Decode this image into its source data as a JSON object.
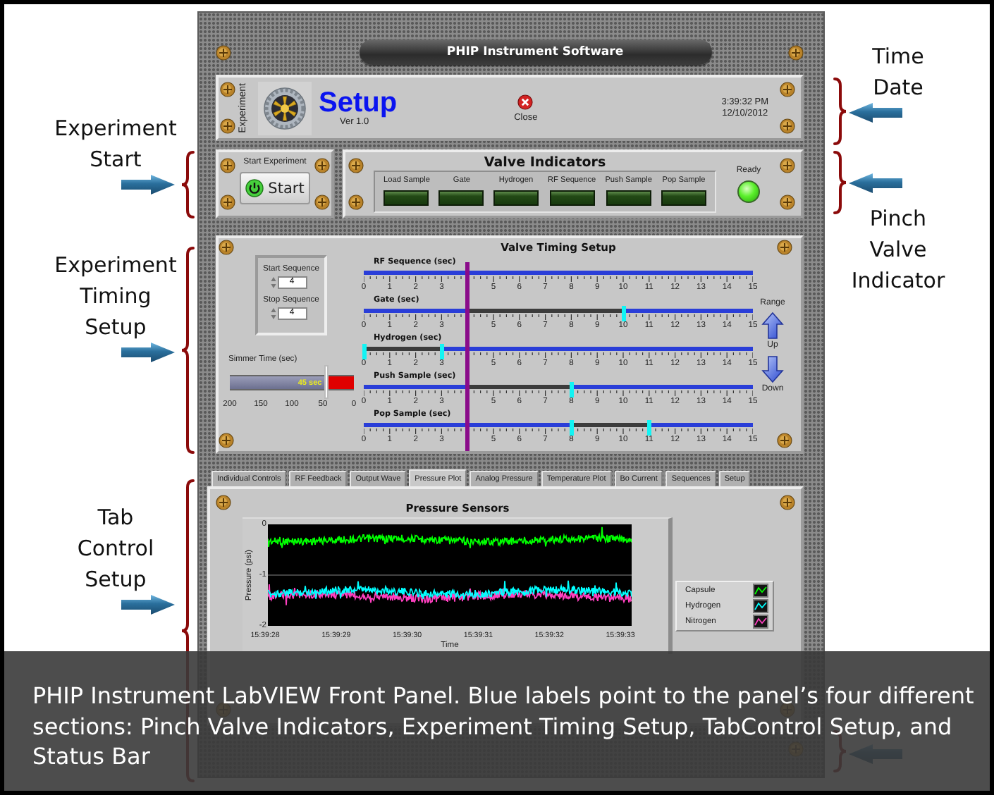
{
  "annotations_left": [
    {
      "label": "Experiment Start"
    },
    {
      "label": "Experiment Timing Setup"
    },
    {
      "label": "Tab Control Setup"
    }
  ],
  "panel_title": "PHIP Instrument Software",
  "header": {
    "side_label": "Experiment",
    "title": "Setup",
    "version": "Ver 1.0",
    "close": "Close",
    "time": "3:39:32 PM",
    "date": "12/10/2012"
  },
  "start": {
    "label": "Start Experiment",
    "button": "Start"
  },
  "valves": {
    "title": "Valve Indicators",
    "items": [
      {
        "label": "Load Sample",
        "on": false
      },
      {
        "label": "Gate",
        "on": false
      },
      {
        "label": "Hydrogen",
        "on": false
      },
      {
        "label": "RF Sequence",
        "on": false
      },
      {
        "label": "Push Sample",
        "on": false
      },
      {
        "label": "Pop Sample",
        "on": false
      }
    ],
    "ready": {
      "label": "Ready",
      "on": true
    }
  },
  "timing": {
    "title": "Valve Timing Setup",
    "sequences": [
      {
        "label": "Start Sequence",
        "value": "4"
      },
      {
        "label": "Stop Sequence",
        "value": "4"
      }
    ],
    "simmer": {
      "label": "Simmer Time (sec)",
      "level": 0.775,
      "reading": "45 sec",
      "scale": [
        "200",
        "150",
        "100",
        "50",
        "0"
      ]
    },
    "cursor": {
      "level": 0.2667
    },
    "tracks": [
      {
        "label": "RF Sequence (sec)",
        "scale": [
          "0",
          "1",
          "2",
          "3",
          "5",
          "6",
          "7",
          "8",
          "9",
          "10",
          "11",
          "12",
          "13",
          "14",
          "15"
        ]
      },
      {
        "label": "Gate (sec)",
        "thumbs": [
          {
            "level": 0.2667
          },
          {
            "level": 0.6667
          }
        ],
        "scale": [
          "0",
          "1",
          "2",
          "3",
          "5",
          "6",
          "7",
          "8",
          "9",
          "10",
          "11",
          "12",
          "13",
          "14",
          "15"
        ]
      },
      {
        "label": "Hydrogen (sec)",
        "thumbs": [
          {
            "level": 0
          },
          {
            "level": 0.2
          }
        ],
        "scale": [
          "0",
          "1",
          "2",
          "3",
          "5",
          "6",
          "7",
          "8",
          "9",
          "10",
          "11",
          "12",
          "13",
          "14",
          "15"
        ]
      },
      {
        "label": "Push Sample (sec)",
        "thumbs": [
          {
            "level": 0.2667
          },
          {
            "level": 0.5333
          }
        ],
        "scale": [
          "0",
          "1",
          "2",
          "3",
          "5",
          "6",
          "7",
          "8",
          "9",
          "10",
          "11",
          "12",
          "13",
          "14",
          "15"
        ]
      },
      {
        "label": "Pop Sample (sec)",
        "thumbs": [
          {
            "level": 0.5333
          },
          {
            "level": 0.7333
          }
        ],
        "scale": [
          "0",
          "1",
          "2",
          "3",
          "5",
          "6",
          "7",
          "8",
          "9",
          "10",
          "11",
          "12",
          "13",
          "14",
          "15"
        ]
      }
    ],
    "range": {
      "label": "Range",
      "up": "Up",
      "down": "Down"
    }
  },
  "tabs": [
    {
      "label": "Individual Controls",
      "selected": false
    },
    {
      "label": "RF Feedback",
      "selected": false
    },
    {
      "label": "Output Wave",
      "selected": false
    },
    {
      "label": "Pressure Plot",
      "selected": true
    },
    {
      "label": "Analog Pressure",
      "selected": false
    },
    {
      "label": "Temperature Plot",
      "selected": false
    },
    {
      "label": "Bo Current",
      "selected": false
    },
    {
      "label": "Sequences",
      "selected": false
    },
    {
      "label": "Setup",
      "selected": false
    }
  ],
  "pressure_plot": {
    "title": "Pressure Sensors",
    "y_label": "Pressure (psi)",
    "y_axis_labels": [
      "0",
      "-1",
      "-2"
    ],
    "x_axis_labels": [
      "15:39:28",
      "15:39:29",
      "15:39:30",
      "15:39:31",
      "15:39:32",
      "15:39:33"
    ],
    "x_label": "Time",
    "legend": [
      {
        "label": "Capsule",
        "color": "#00ff00"
      },
      {
        "label": "Hydrogen",
        "color": "#00ffff"
      },
      {
        "label": "Nitrogen",
        "color": "#ff40c0"
      }
    ]
  },
  "annotations_right": [
    {
      "label": "Time Date"
    },
    {
      "label": "Pinch Valve Indicator"
    }
  ],
  "caption": "PHIP Instrument LabVIEW Front Panel. Blue labels point to the panel’s four different sections: Pinch Valve Indicators, Experiment Timing Setup, TabControl Setup, and Status Bar"
}
